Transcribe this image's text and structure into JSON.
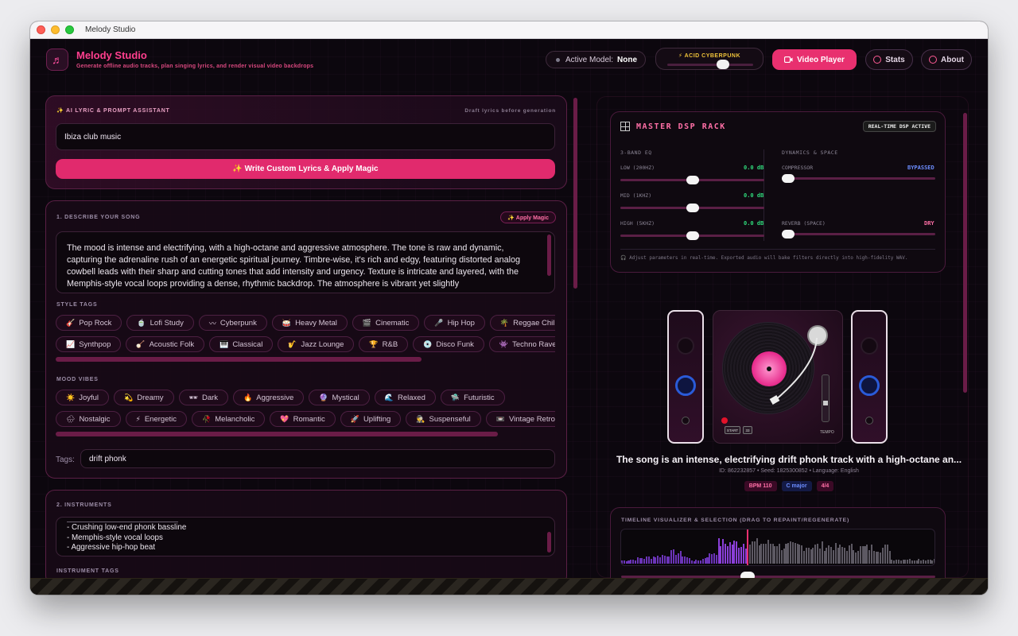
{
  "window": {
    "title": "Melody Studio"
  },
  "header": {
    "app_name": "Melody Studio",
    "subtitle": "Generate offline audio tracks, plan singing lyrics, and render visual video backdrops",
    "active_model_label": "Active Model:",
    "active_model_value": "None",
    "theme_label": "⚡ ACID CYBERPUNK",
    "theme_level": 0.65,
    "video_player_label": "Video Player",
    "stats_label": "Stats",
    "about_label": "About"
  },
  "ai_assistant": {
    "title": "✨ AI LYRIC & PROMPT ASSISTANT",
    "hint": "Draft lyrics before generation",
    "input_value": "Ibiza club music",
    "button_label": "✨ Write Custom Lyrics & Apply Magic"
  },
  "describe": {
    "title": "1. DESCRIBE YOUR SONG",
    "apply_magic_label": "✨ Apply Magic",
    "description": "The mood is intense and electrifying, with a high-octane and aggressive atmosphere. The tone is raw and dynamic, capturing the adrenaline rush of an energetic spiritual journey. Timbre-wise, it's rich and edgy, featuring distorted analog cowbell leads with their sharp and cutting tones that add intensity and urgency. Texture is intricate and layered, with the Memphis-style vocal loops providing a dense, rhythmic backdrop. The atmosphere is vibrant yet slightly",
    "style_tags_label": "STYLE TAGS",
    "style_tags_row1": [
      {
        "icon": "🎸",
        "label": "Pop Rock"
      },
      {
        "icon": "🍵",
        "label": "Lofi Study"
      },
      {
        "icon": "〰",
        "label": "Cyberpunk"
      },
      {
        "icon": "🥁",
        "label": "Heavy Metal"
      },
      {
        "icon": "🎬",
        "label": "Cinematic"
      },
      {
        "icon": "🎤",
        "label": "Hip Hop"
      },
      {
        "icon": "🌴",
        "label": "Reggae Chill"
      }
    ],
    "style_tags_row2": [
      {
        "icon": "📈",
        "label": "Synthpop"
      },
      {
        "icon": "🪕",
        "label": "Acoustic Folk"
      },
      {
        "icon": "🎹",
        "label": "Classical"
      },
      {
        "icon": "🎷",
        "label": "Jazz Lounge"
      },
      {
        "icon": "🏆",
        "label": "R&B"
      },
      {
        "icon": "💿",
        "label": "Disco Funk"
      },
      {
        "icon": "👾",
        "label": "Techno Rave"
      }
    ],
    "mood_label": "MOOD VIBES",
    "mood_row1": [
      {
        "icon": "☀️",
        "label": "Joyful"
      },
      {
        "icon": "💫",
        "label": "Dreamy"
      },
      {
        "icon": "🕶",
        "label": "Dark"
      },
      {
        "icon": "🔥",
        "label": "Aggressive"
      },
      {
        "icon": "🔮",
        "label": "Mystical"
      },
      {
        "icon": "🌊",
        "label": "Relaxed"
      },
      {
        "icon": "🛸",
        "label": "Futuristic"
      }
    ],
    "mood_row2": [
      {
        "icon": "🌧",
        "label": "Nostalgic"
      },
      {
        "icon": "⚡",
        "label": "Energetic"
      },
      {
        "icon": "🥀",
        "label": "Melancholic"
      },
      {
        "icon": "💖",
        "label": "Romantic"
      },
      {
        "icon": "🚀",
        "label": "Uplifting"
      },
      {
        "icon": "🕵",
        "label": "Suspenseful"
      },
      {
        "icon": "📼",
        "label": "Vintage Retro"
      }
    ],
    "tags_label": "Tags:",
    "tags_value": "drift phonk"
  },
  "instruments": {
    "title": "2. INSTRUMENTS",
    "lines": [
      "- Crushing low-end phonk bassline",
      "- Memphis-style vocal loops",
      "- Aggressive hip-hop beat"
    ],
    "tags_label": "INSTRUMENT TAGS"
  },
  "dsp": {
    "title": "MASTER DSP RACK",
    "badge": "REAL-TIME DSP ACTIVE",
    "eq_label": "3-BAND EQ",
    "dyn_label": "DYNAMICS & SPACE",
    "low_label": "LOW (200HZ)",
    "low_value": "0.0 dB",
    "mid_label": "MID (1KHZ)",
    "mid_value": "0.0 dB",
    "high_label": "HIGH (5KHZ)",
    "high_value": "0.0 dB",
    "comp_label": "COMPRESSOR",
    "comp_value": "BYPASSED",
    "reverb_label": "REVERB (SPACE)",
    "reverb_value": "DRY",
    "footer": "🎧 Adjust parameters in real-time. Exported audio will bake filters directly into high-fidelity WAV.",
    "eq_level": 0.5,
    "comp_level": 0,
    "reverb_level": 0
  },
  "deck": {
    "start_label": "START",
    "stop_label": "33",
    "tempo_label": "TEMPO"
  },
  "song": {
    "title": "The song is an intense, electrifying drift phonk track with a high-octane an...",
    "meta": "ID: 862232857 • Seed: 1825300852 • Language: English",
    "bpm": "BPM 110",
    "key": "C major",
    "time_sig": "4/4"
  },
  "timeline": {
    "title": "TIMELINE VISUALIZER & SELECTION (DRAG TO REPAINT/REGENERATE)",
    "playhead_fraction": 0.4,
    "selection_fraction": 0.38
  },
  "colors": {
    "accent": "#e8306f",
    "accent_text": "#ff3f8e",
    "wave_selected": "#8a3fd8",
    "wave_unselected": "#5d5963"
  }
}
